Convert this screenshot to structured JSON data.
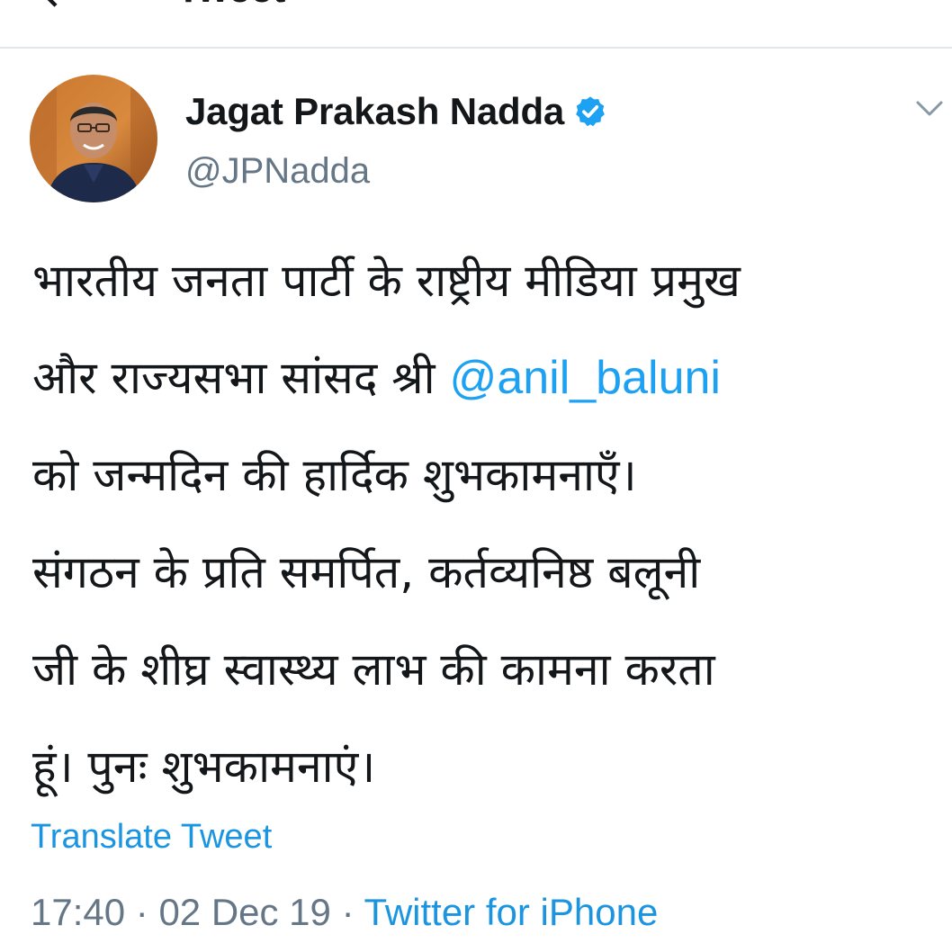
{
  "top_bar": {
    "back_glyph": "←",
    "title": "Tweet"
  },
  "author": {
    "name": "Jagat Prakash Nadda",
    "verified": true,
    "handle": "@JPNadda",
    "avatar_icon": "avatar"
  },
  "tweet": {
    "lines": [
      "भारतीय जनता पार्टी के राष्ट्रीय मीडिया प्रमुख",
      "और राज्यसभा सांसद श्री ",
      "को जन्मदिन की हार्दिक शुभकामनाएँ।",
      "संगठन के प्रति समर्पित, कर्तव्यनिष्ठ बलूनी",
      "जी के शीघ्र स्वास्थ्य लाभ की कामना करता",
      "हूं। पुनः शुभकामनाएं।"
    ],
    "mention": "@anil_baluni"
  },
  "translate_label": "Translate Tweet",
  "meta": {
    "time": "17:40",
    "separator": " · ",
    "date": "02 Dec 19",
    "source": "Twitter for iPhone"
  },
  "colors": {
    "text_primary": "#14171a",
    "text_secondary": "#657786",
    "link": "#1da1f2",
    "verified_badge": "#1da1f2",
    "divider": "#e1e8ed"
  }
}
